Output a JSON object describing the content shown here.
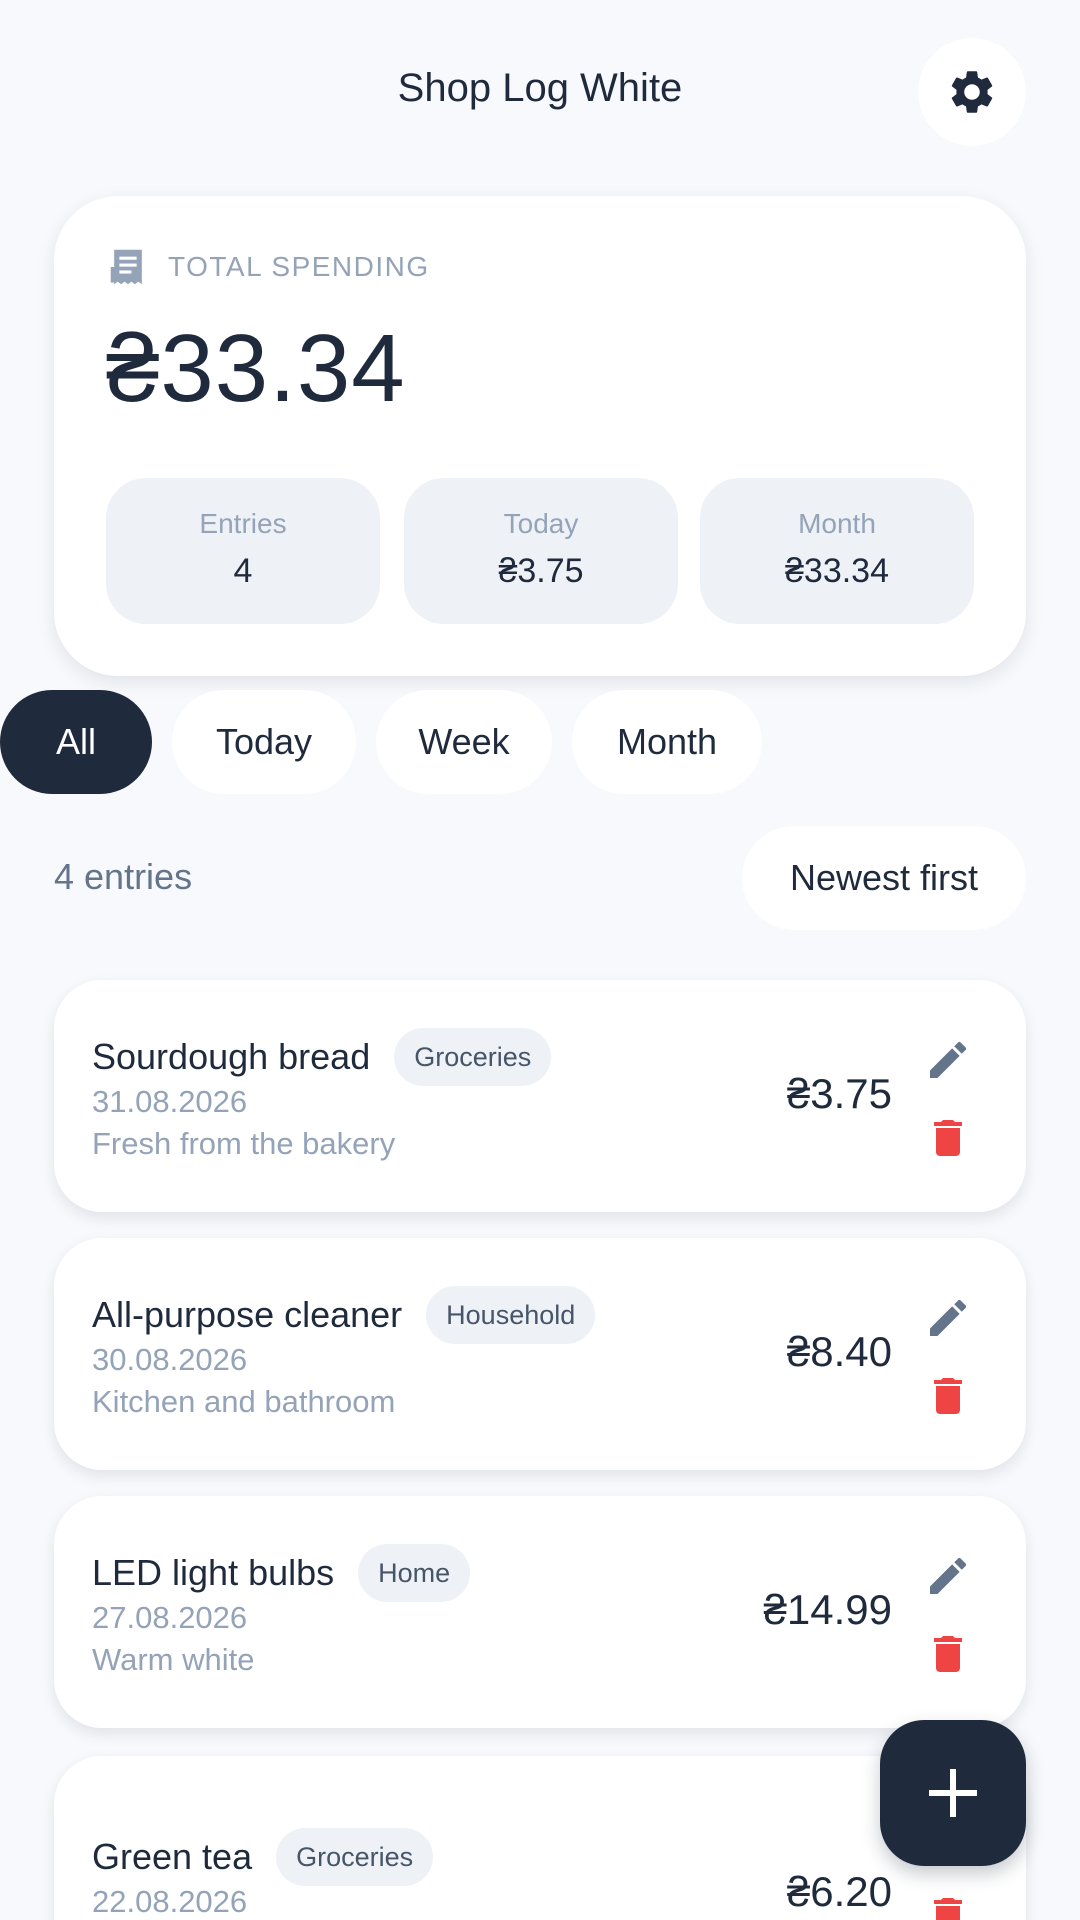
{
  "header": {
    "title": "Shop Log White",
    "settings_icon": "gear-icon"
  },
  "summary": {
    "icon": "receipt-icon",
    "label": "TOTAL SPENDING",
    "total": "₴33.34",
    "stats": [
      {
        "label": "Entries",
        "value": "4"
      },
      {
        "label": "Today",
        "value": "₴3.75"
      },
      {
        "label": "Month",
        "value": "₴33.34"
      }
    ]
  },
  "filters": {
    "chips": [
      "All",
      "Today",
      "Week",
      "Month"
    ],
    "selected": "All"
  },
  "list": {
    "count_text": "4 entries",
    "sort_label": "Newest first",
    "entries": [
      {
        "name": "Sourdough bread",
        "tag": "Groceries",
        "date": "31.08.2026",
        "note": "Fresh from the bakery",
        "amount": "₴3.75"
      },
      {
        "name": "All-purpose cleaner",
        "tag": "Household",
        "date": "30.08.2026",
        "note": "Kitchen and bathroom",
        "amount": "₴8.40"
      },
      {
        "name": "LED light bulbs",
        "tag": "Home",
        "date": "27.08.2026",
        "note": "Warm white",
        "amount": "₴14.99"
      },
      {
        "name": "Green tea",
        "tag": "Groceries",
        "date": "22.08.2026",
        "note": "",
        "amount": "₴6.20"
      }
    ]
  },
  "fab": {
    "icon": "plus-icon"
  },
  "colors": {
    "background": "#f7f9fc",
    "primary_dark": "#1f2a3d",
    "muted_text": "#94a3b8",
    "edit_icon": "#64748b",
    "delete_icon": "#ef4444",
    "chip_surface": "#eef2f7"
  }
}
